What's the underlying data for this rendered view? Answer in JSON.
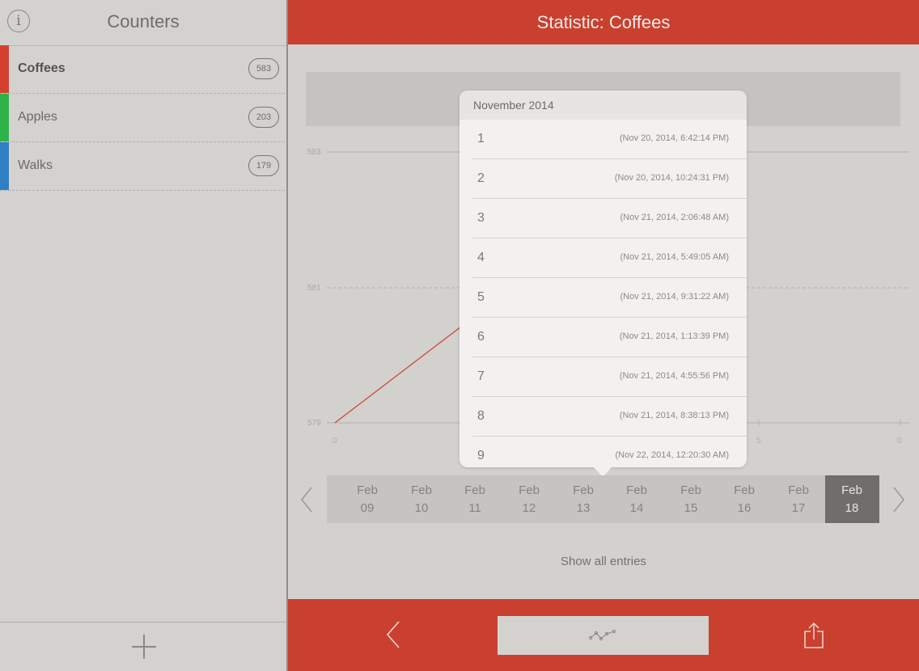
{
  "sidebar": {
    "title": "Counters",
    "info_glyph": "i",
    "counters": [
      {
        "label": "Coffees",
        "count": "583",
        "color": "#d4402f"
      },
      {
        "label": "Apples",
        "count": "203",
        "color": "#2fb24a"
      },
      {
        "label": "Walks",
        "count": "179",
        "color": "#2f7fc4"
      }
    ]
  },
  "main": {
    "title": "Statistic: Coffees",
    "show_all_label": "Show all entries"
  },
  "chart_data": {
    "type": "line",
    "y_ticks": [
      "583",
      "581",
      "579"
    ],
    "x_ticks": [
      "0",
      "5",
      "0"
    ],
    "series": [
      {
        "x": [
          0,
          1
        ],
        "y": [
          579,
          581.6
        ]
      }
    ],
    "ylim": [
      579,
      583
    ],
    "line_color": "#c9402f",
    "grid": true
  },
  "popover": {
    "header": "November 2014",
    "entries": [
      {
        "num": "1",
        "time": "(Nov 20, 2014, 6:42:14 PM)"
      },
      {
        "num": "2",
        "time": "(Nov 20, 2014, 10:24:31 PM)"
      },
      {
        "num": "3",
        "time": "(Nov 21, 2014, 2:06:48 AM)"
      },
      {
        "num": "4",
        "time": "(Nov 21, 2014, 5:49:05 AM)"
      },
      {
        "num": "5",
        "time": "(Nov 21, 2014, 9:31:22 AM)"
      },
      {
        "num": "6",
        "time": "(Nov 21, 2014, 1:13:39 PM)"
      },
      {
        "num": "7",
        "time": "(Nov 21, 2014, 4:55:56 PM)"
      },
      {
        "num": "8",
        "time": "(Nov 21, 2014, 8:38:13 PM)"
      },
      {
        "num": "9",
        "time": "(Nov 22, 2014, 12:20:30 AM)"
      }
    ]
  },
  "dates": [
    {
      "m": "Feb",
      "d": "09"
    },
    {
      "m": "Feb",
      "d": "10"
    },
    {
      "m": "Feb",
      "d": "11"
    },
    {
      "m": "Feb",
      "d": "12"
    },
    {
      "m": "Feb",
      "d": "13"
    },
    {
      "m": "Feb",
      "d": "14"
    },
    {
      "m": "Feb",
      "d": "15"
    },
    {
      "m": "Feb",
      "d": "16"
    },
    {
      "m": "Feb",
      "d": "17"
    },
    {
      "m": "Feb",
      "d": "18",
      "selected": true
    }
  ],
  "icons": {
    "prev": "chevron-left-icon",
    "next": "chevron-right-icon",
    "back": "chevron-left-icon",
    "graph": "line-graph-icon",
    "share": "share-icon",
    "add": "plus-icon",
    "info": "info-icon"
  }
}
